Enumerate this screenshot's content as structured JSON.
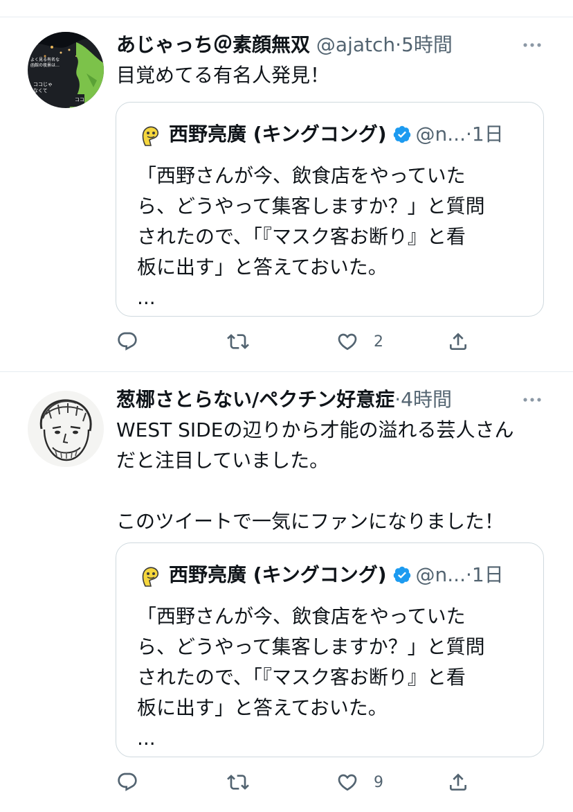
{
  "tweets": [
    {
      "author_name": "あじゃっち＠素顔無双",
      "handle": "@ajatch",
      "separator": "·",
      "time": "5時間",
      "avatar_text": [
        "よく見る有名な",
        "函館の夜景は…",
        "ココじゃ",
        "なくて",
        "ココ"
      ],
      "text": "目覚めてる有名人発見！",
      "quote": {
        "author_name": "西野亮廣 (キングコング)",
        "handle": "@n...",
        "separator": "·",
        "time": "1日",
        "text": "「西野さんが今、飲食店をやっていた\nら、どうやって集客しますか？」と質問\nされたので、「『マスク客お断り』と看\n板に出す」と答えておいた。\n..."
      },
      "actions": {
        "reply_count": "",
        "retweet_count": "",
        "like_count": "2"
      }
    },
    {
      "author_name": "葱梛さとらない/ペクチン好意症",
      "handle": "",
      "separator": "·",
      "time": "4時間",
      "text": "WEST SIDEの辺りから才能の溢れる芸人さん\nだと注目していました。\n\nこのツイートで一気にファンになりました！",
      "quote": {
        "author_name": "西野亮廣 (キングコング)",
        "handle": "@n...",
        "separator": "·",
        "time": "1日",
        "text": "「西野さんが今、飲食店をやっていた\nら、どうやって集客しますか？」と質問\nされたので、「『マスク客お断り』と看\n板に出す」と答えておいた。\n..."
      },
      "actions": {
        "reply_count": "",
        "retweet_count": "",
        "like_count": "9"
      }
    }
  ],
  "colors": {
    "text": "#0f1419",
    "secondary": "#536471",
    "border": "#cfd9de",
    "divider": "#e6ecf0",
    "verified": "#1d9bf0"
  },
  "icons": [
    "more-icon",
    "reply-icon",
    "retweet-icon",
    "like-icon",
    "share-icon",
    "verified-icon"
  ]
}
